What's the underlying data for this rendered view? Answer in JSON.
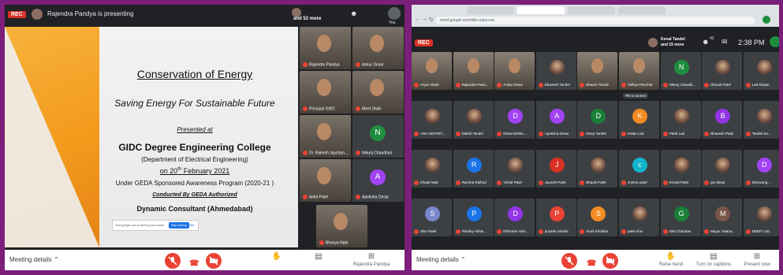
{
  "left": {
    "presenting_text": "Rajendra Pandya is presenting",
    "more_text": "and 53 more",
    "you_label": "You",
    "rec_label": "REC",
    "slide": {
      "title": "Conservation of Energy",
      "subtitle": "Saving Energy For Sustainable Future",
      "presented_at": "Presented at",
      "college": "GIDC Degree Engineering College",
      "department": "(Department of Electrical Engineering)",
      "date_prefix": "on 20",
      "date_sup": "th",
      "date_suffix": " February 2021",
      "program": "Under GEDA Sponsored Awareness Program (2020-21 )",
      "conducted_by": "Conducted By GEDA Authorized",
      "consultant": "Dynamic Consultant (Ahmedabad)",
      "share_bar_text": "meet.google.com is sharing your screen.",
      "share_stop": "Stop sharing",
      "share_hide": "Hide"
    },
    "participants": [
      {
        "name": "Rajendra Pandya",
        "kind": "video"
      },
      {
        "name": "Ankur Desai",
        "kind": "video"
      },
      {
        "name": "Principal GIDC",
        "kind": "video"
      },
      {
        "name": "Meet Shah",
        "kind": "video"
      },
      {
        "name": "Dr. Rakesh Jaychan...",
        "kind": "video"
      },
      {
        "name": "Nikunj Chaudhari",
        "kind": "avatar",
        "initial": "N",
        "color": "#1e8e3e"
      },
      {
        "name": "Ankit Patel",
        "kind": "video"
      },
      {
        "name": "Apeksha Desai",
        "kind": "avatar",
        "initial": "A",
        "color": "#a142f4"
      },
      {
        "name": "Bhavya Naik",
        "kind": "video"
      }
    ],
    "meeting_details": "Meeting details",
    "presenter_label": "Rajendra Pandya"
  },
  "right": {
    "url": "meet.google.com/dbs-mpeu-ue",
    "rec_label": "REC",
    "owner_text": "Kenal Tandel",
    "owner_more": "and 19 more",
    "people_count": "42",
    "time": "2:38 PM",
    "you_label": "You",
    "pin_tooltip": "Pin to screen",
    "rows": [
      [
        {
          "name": "Aryan Shah",
          "kind": "video"
        },
        {
          "name": "Rajendra Pand...",
          "kind": "video"
        },
        {
          "name": "Ankur Desai",
          "kind": "video"
        },
        {
          "name": "Bhavesh Tandel",
          "kind": "photo"
        },
        {
          "name": "Bhavin Trivedi",
          "kind": "video"
        },
        {
          "name": "Vidhya Panchal",
          "kind": "video"
        },
        {
          "name": "Nikunj Chaudh...",
          "kind": "avatar",
          "initial": "N",
          "color": "#1e8e3e"
        },
        {
          "name": "Dhaval Patel",
          "kind": "photo"
        },
        {
          "name": "Lad Kirpan",
          "kind": "photo"
        }
      ],
      [
        {
          "name": "ASH DEPART...",
          "kind": "photo"
        },
        {
          "name": "Daksh Tandel",
          "kind": "photo"
        },
        {
          "name": "Dharmishtha ...",
          "kind": "avatar",
          "initial": "D",
          "color": "#a142f4"
        },
        {
          "name": "Apeksha Desai",
          "kind": "avatar",
          "initial": "A",
          "color": "#a142f4"
        },
        {
          "name": "Deep Tandel",
          "kind": "avatar",
          "initial": "D",
          "color": "#188038"
        },
        {
          "name": "Ketan Lad",
          "kind": "avatar",
          "initial": "K",
          "color": "#f28b22"
        },
        {
          "name": "Parth Lad",
          "kind": "photo"
        },
        {
          "name": "Bhavesh Patel",
          "kind": "avatar",
          "initial": "B",
          "color": "#9334e6"
        },
        {
          "name": "Tandel Sa...",
          "kind": "photo"
        }
      ],
      [
        {
          "name": "Khyati Naik",
          "kind": "photo"
        },
        {
          "name": "Rachna Rathod",
          "kind": "avatar",
          "initial": "R",
          "color": "#1a73e8"
        },
        {
          "name": "Vishal Patel",
          "kind": "photo"
        },
        {
          "name": "Jaynish Patel",
          "kind": "avatar",
          "initial": "J",
          "color": "#d93025"
        },
        {
          "name": "Bhavik Patel",
          "kind": "photo"
        },
        {
          "name": "chetna patel",
          "kind": "avatar",
          "initial": "c",
          "color": "#12b5cb"
        },
        {
          "name": "Krunal Patel",
          "kind": "photo"
        },
        {
          "name": "jay desai",
          "kind": "photo"
        },
        {
          "name": "Dhruvang...",
          "kind": "avatar",
          "initial": "D",
          "color": "#a142f4"
        }
      ],
      [
        {
          "name": "Shiv Patel",
          "kind": "avatar",
          "initial": "S",
          "color": "#7986cb"
        },
        {
          "name": "Pandey Abhis...",
          "kind": "avatar",
          "initial": "P",
          "color": "#1a73e8"
        },
        {
          "name": "Dhimmar Hari...",
          "kind": "avatar",
          "initial": "D",
          "color": "#9334e6"
        },
        {
          "name": "priyank solanki",
          "kind": "avatar",
          "initial": "P",
          "color": "#ea4335"
        },
        {
          "name": "Sunil Khokhar",
          "kind": "avatar",
          "initial": "S",
          "color": "#f28b22"
        },
        {
          "name": "patel shiv",
          "kind": "photo"
        },
        {
          "name": "Gita Chauhan",
          "kind": "avatar",
          "initial": "G",
          "color": "#188038"
        },
        {
          "name": "Mayur Jalana...",
          "kind": "avatar",
          "initial": "M",
          "color": "#795548"
        },
        {
          "name": "DEEP LAD",
          "kind": "photo"
        }
      ]
    ],
    "meeting_details": "Meeting details",
    "raise_hand": "Raise hand",
    "captions": "Turn on captions",
    "present": "Present now"
  }
}
